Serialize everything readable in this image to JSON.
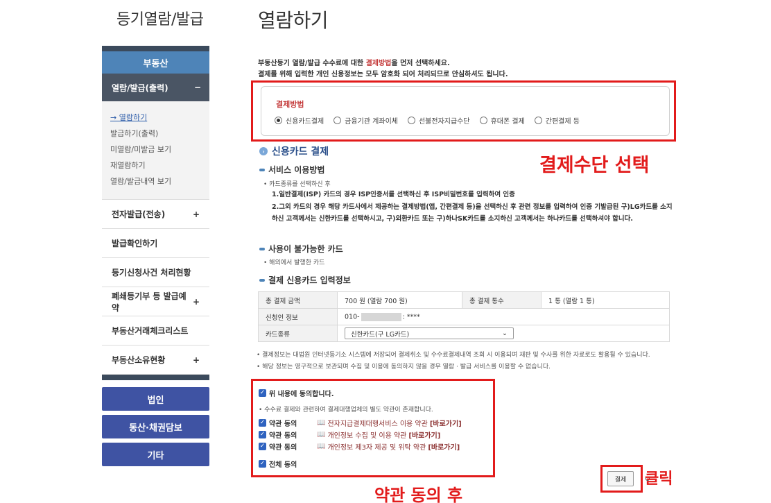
{
  "sidebar": {
    "heading": "등기열람/발급",
    "category": "부동산",
    "expanded_item": {
      "label": "열람/발급(출력)",
      "toggle": "−"
    },
    "sub_items": [
      "→ 열람하기",
      "발급하기(출력)",
      "미열람/미발급 보기",
      "재열람하기",
      "열람/발급내역 보기"
    ],
    "items": [
      {
        "label": "전자발급(전송)",
        "toggle": "+"
      },
      {
        "label": "발급확인하기",
        "toggle": ""
      },
      {
        "label": "등기신청사건 처리현황",
        "toggle": ""
      },
      {
        "label": "폐쇄등기부 등 발급예약",
        "toggle": "+"
      },
      {
        "label": "부동산거래체크리스트",
        "toggle": ""
      },
      {
        "label": "부동산소유현황",
        "toggle": "+"
      }
    ],
    "bottom_buttons": [
      "법인",
      "동산·채권담보",
      "기타"
    ]
  },
  "main": {
    "title": "열람하기",
    "intro_1a": "부동산등기 열람/발급 수수료에 대한 ",
    "intro_1b": "결제방법",
    "intro_1c": "을 먼저 선택하세요.",
    "intro_2": "결제를 위해 입력한 개인 신용정보는 모두 암호화 되어 처리되므로 안심하셔도 됩니다.",
    "payment_method": {
      "title": "결제방법",
      "options": [
        "신용카드결제",
        "금융기관 계좌이체",
        "선불전자지급수단",
        "휴대폰 결제",
        "간편결제 등"
      ],
      "selected": 0
    },
    "section_title": "신용카드 결제",
    "service": {
      "heading": "서비스 이용방법",
      "bullet": "• 카드종류를 선택하신 후",
      "step1": "1.일반결제(ISP) 카드의 경우 ISP인증서를 선택하신 후 ISP비밀번호를 입력하여 인증",
      "step2": "2.그외 카드의 경우 해당 카드사에서 제공하는 결제방법(앱, 간편결제 등)을 선택하신 후 관련 정보를 입력하여 인증 기발급된 구)LG카드를 소지하신 고객께서는 신한카드를 선택하시고, 구)외환카드 또는 구)하나SK카드를 소지하신 고객께서는 하나카드를 선택하셔야 합니다."
    },
    "unavailable": {
      "heading": "사용이 불가능한 카드",
      "bullet": "• 해외에서 발행한 카드"
    },
    "card_info": {
      "heading": "결제 신용카드 입력정보",
      "total_amount_label": "총 결제 금액",
      "total_amount": "700 원 (열람 700 원)",
      "total_count_label": "총 결제 통수",
      "total_count": "1 통 (열람 1 통)",
      "applicant_label": "신청인 정보",
      "applicant_prefix": "010-",
      "applicant_suffix": ": ****",
      "card_type_label": "카드종류",
      "card_type_value": "신한카드(구 LG카드)"
    },
    "notes": [
      "• 결제정보는 대법원 인터넷등기소 시스템에 저장되어 결제취소 및 수수료결제내역 조회 시 이용되며 재판 및 수사를 위한 자료로도 활용될 수 있습니다.",
      "• 해당 정보는 영구적으로 보관되며 수집 및 이용에 동의하지 않을 경우 열람 · 발급 서비스를 이용할 수 없습니다."
    ],
    "agree_main": "위 내용에 동의합니다.",
    "agree_note": "• 수수료 결제와 관련하여 결제대행업체의 별도 약관이 존재합니다.",
    "terms": [
      {
        "label": "약관 동의",
        "name": "전자지급결제대행서비스 이용 약관",
        "link": "[바로가기]"
      },
      {
        "label": "약관 동의",
        "name": "개인정보 수집 및 이용 약관",
        "link": "[바로가기]"
      },
      {
        "label": "약관 동의",
        "name": "개인정보 제3자 제공 및 위탁 약관",
        "link": "[바로가기]"
      }
    ],
    "agree_all": "전체 동의",
    "pay_button": "결제"
  },
  "annotations": {
    "select_method": "결제수단 선택",
    "click": "클릭",
    "after_agree": "약관 동의 후"
  },
  "colors": {
    "accent_red": "#e21b1b",
    "sidebar_blue": "#4e84b8",
    "button_navy": "#3f53a3"
  }
}
